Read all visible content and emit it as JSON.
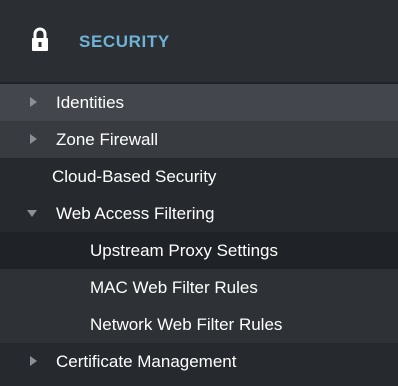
{
  "header": {
    "title": "SECURITY",
    "icon": "lock-icon"
  },
  "items": [
    {
      "label": "Identities",
      "arrow": "right"
    },
    {
      "label": "Zone Firewall",
      "arrow": "right"
    },
    {
      "label": "Cloud-Based Security"
    },
    {
      "label": "Web Access Filtering",
      "arrow": "down"
    },
    {
      "label": "Upstream Proxy Settings"
    },
    {
      "label": "MAC Web Filter Rules"
    },
    {
      "label": "Network Web Filter Rules"
    },
    {
      "label": "Certificate Management",
      "arrow": "right"
    }
  ]
}
